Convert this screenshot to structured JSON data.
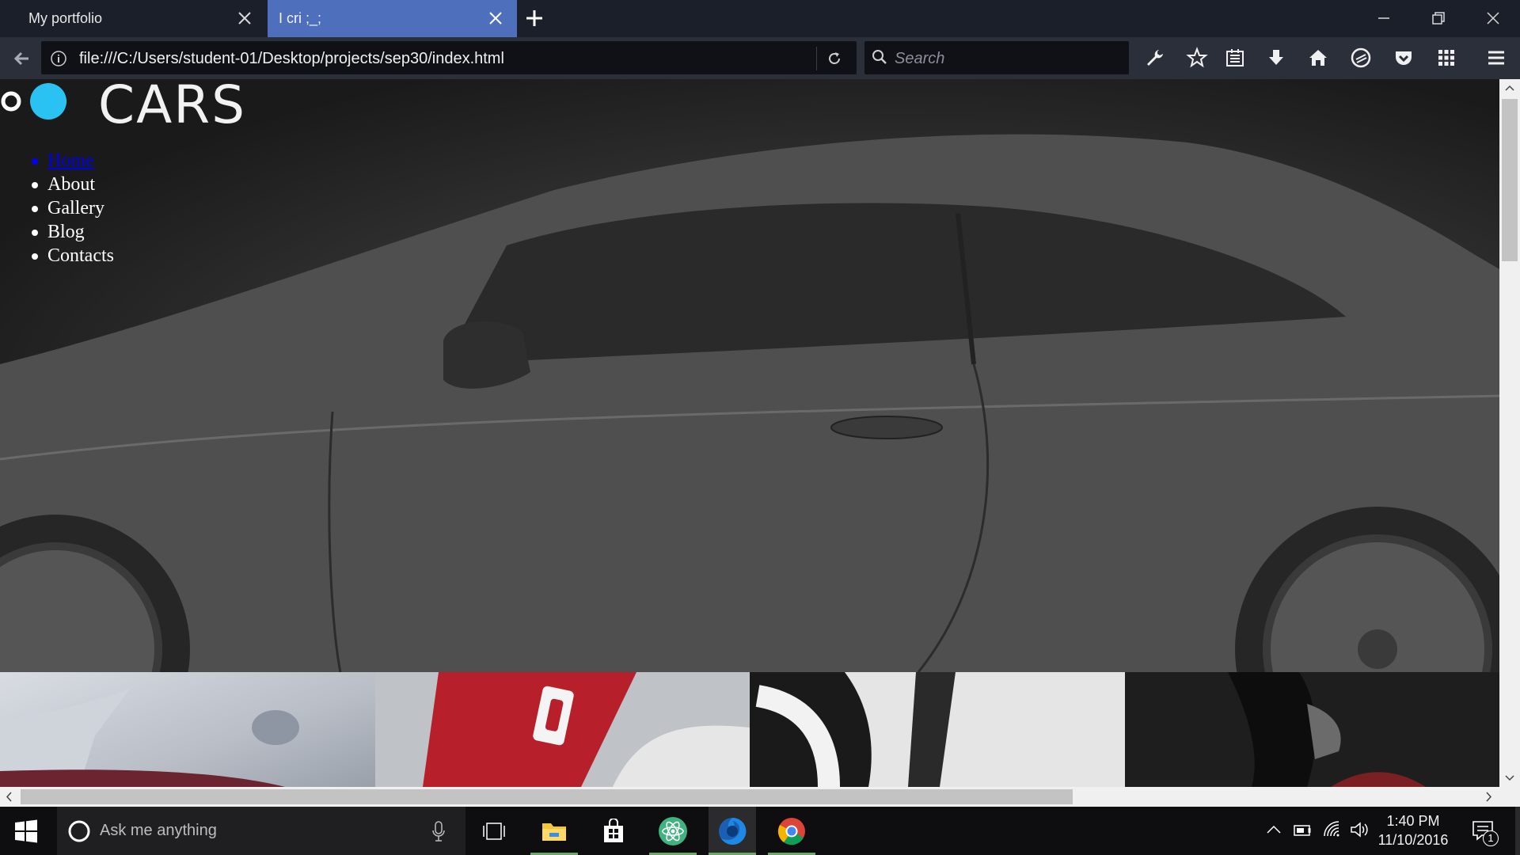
{
  "browser": {
    "tabs": [
      {
        "label": "My portfolio",
        "active": false
      },
      {
        "label": "I cri ;_;",
        "active": true
      }
    ],
    "url": "file:///C:/Users/student-01/Desktop/projects/sep30/index.html",
    "search_placeholder": "Search",
    "toolbar_icons": [
      "wrench-icon",
      "bookmark-star-icon",
      "reading-list-icon",
      "download-icon",
      "home-icon",
      "sync-icon",
      "pocket-icon",
      "apps-grid-icon",
      "menu-icon"
    ]
  },
  "page": {
    "logo_text": "CARS",
    "nav": [
      {
        "label": "Home",
        "active": true
      },
      {
        "label": "About",
        "active": false
      },
      {
        "label": "Gallery",
        "active": false
      },
      {
        "label": "Blog",
        "active": false
      },
      {
        "label": "Contacts",
        "active": false
      }
    ],
    "colors": {
      "logo_accent": "#29c2f2",
      "link_active": "#0000ee"
    }
  },
  "taskbar": {
    "search_placeholder": "Ask me anything",
    "time": "1:40 PM",
    "date": "11/10/2016",
    "notification_count": "1",
    "apps": [
      "task-view-icon",
      "file-explorer-icon",
      "store-icon",
      "atom-icon",
      "firefox-icon",
      "chrome-icon"
    ]
  }
}
